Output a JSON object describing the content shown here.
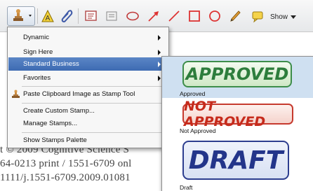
{
  "toolbar": {
    "tools": [
      {
        "name": "stamp-tool",
        "label": ""
      },
      {
        "name": "highlight-tool",
        "label": ""
      },
      {
        "name": "attach-tool",
        "label": ""
      },
      {
        "name": "text-box-tool",
        "label": ""
      },
      {
        "name": "note-tool",
        "label": ""
      },
      {
        "name": "cloud-tool",
        "label": ""
      },
      {
        "name": "arrow-tool",
        "label": ""
      },
      {
        "name": "line-tool",
        "label": ""
      },
      {
        "name": "rectangle-tool",
        "label": ""
      },
      {
        "name": "oval-tool",
        "label": ""
      },
      {
        "name": "pencil-tool",
        "label": ""
      }
    ],
    "show_label": "Show"
  },
  "menu": {
    "items": [
      {
        "label": "Dynamic",
        "submenu": true
      },
      {
        "label": "Sign Here",
        "submenu": true
      },
      {
        "label": "Standard Business",
        "submenu": true,
        "highlighted": true
      },
      {
        "label": "Favorites",
        "submenu": true
      },
      {
        "label": "Paste Clipboard Image as Stamp Tool",
        "icon": "stamp-icon"
      },
      {
        "label": "Create Custom Stamp..."
      },
      {
        "label": "Manage Stamps..."
      },
      {
        "label": "Show Stamps Palette"
      }
    ]
  },
  "submenu": {
    "stamps": [
      {
        "text": "APPROVED",
        "caption": "Approved",
        "color": "#2d7d3c",
        "highlighted": true
      },
      {
        "text": "NOT APPROVED",
        "caption": "Not Approved",
        "color": "#c62b1c"
      },
      {
        "text": "DRAFT",
        "caption": "Draft",
        "color": "#23358a"
      }
    ]
  },
  "document": {
    "lines": [
      "t © 2009 Cognitive Science S",
      "64-0213 print / 1551-6709 onl",
      "1111/j.1551-6709.2009.01081"
    ]
  }
}
